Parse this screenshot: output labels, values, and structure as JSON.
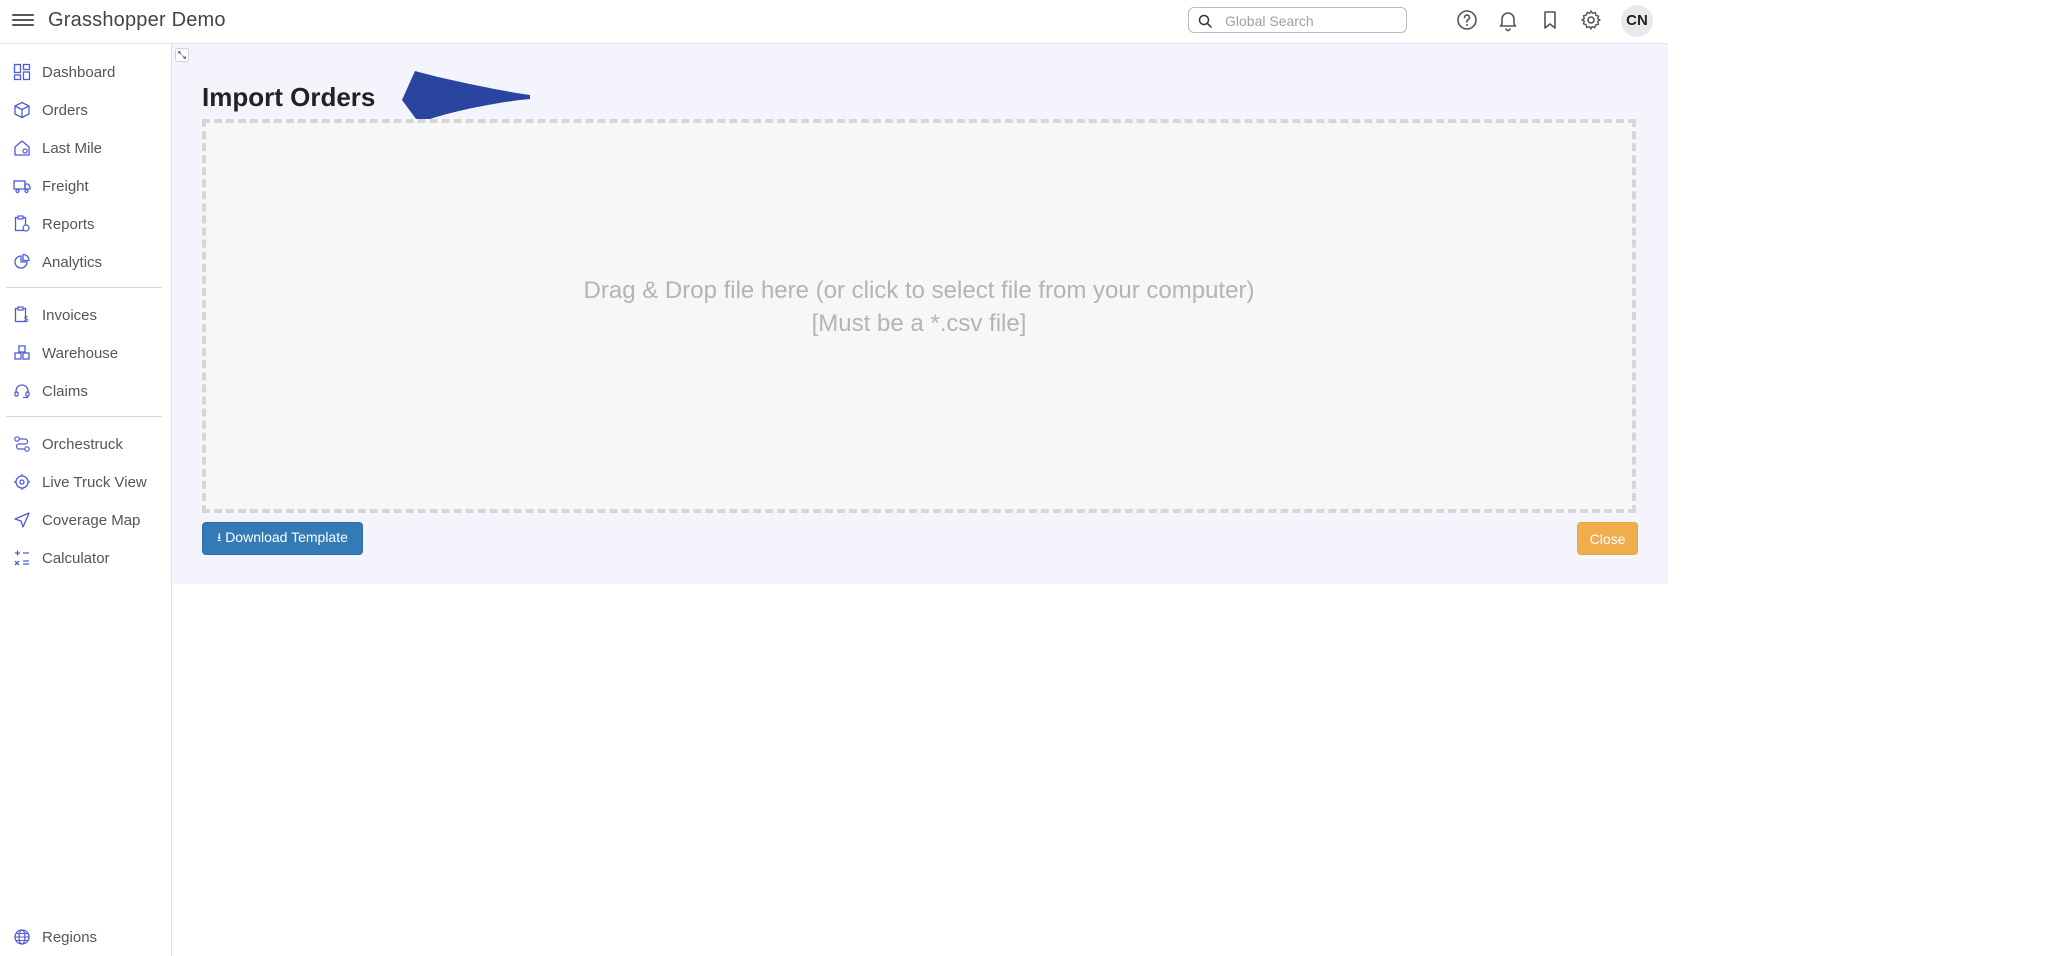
{
  "header": {
    "title": "Grasshopper Demo",
    "search_placeholder": "Global Search",
    "avatar_initials": "CN"
  },
  "sidebar": {
    "items": [
      {
        "label": "Dashboard",
        "icon": "dashboard-icon"
      },
      {
        "label": "Orders",
        "icon": "box-icon"
      },
      {
        "label": "Last Mile",
        "icon": "house-icon"
      },
      {
        "label": "Freight",
        "icon": "truck-icon"
      },
      {
        "label": "Reports",
        "icon": "report-icon"
      },
      {
        "label": "Analytics",
        "icon": "analytics-icon"
      },
      {
        "label": "Invoices",
        "icon": "invoice-icon"
      },
      {
        "label": "Warehouse",
        "icon": "warehouse-icon"
      },
      {
        "label": "Claims",
        "icon": "headset-icon"
      },
      {
        "label": "Orchestruck",
        "icon": "route-icon"
      },
      {
        "label": "Live Truck View",
        "icon": "target-icon"
      },
      {
        "label": "Coverage Map",
        "icon": "navigation-icon"
      },
      {
        "label": "Calculator",
        "icon": "calculator-icon"
      },
      {
        "label": "Regions",
        "icon": "globe-icon"
      }
    ]
  },
  "main": {
    "title": "Import Orders",
    "dropzone_line1": "Drag & Drop file here (or click to select file from your computer)",
    "dropzone_line2": "[Must be a *.csv file]",
    "download_label": "Download Template",
    "close_label": "Close"
  },
  "colors": {
    "accent": "#4f5bd5",
    "download_button": "#337ab7",
    "close_button": "#f0ad4e",
    "annotation_arrow": "#2a45a0"
  }
}
